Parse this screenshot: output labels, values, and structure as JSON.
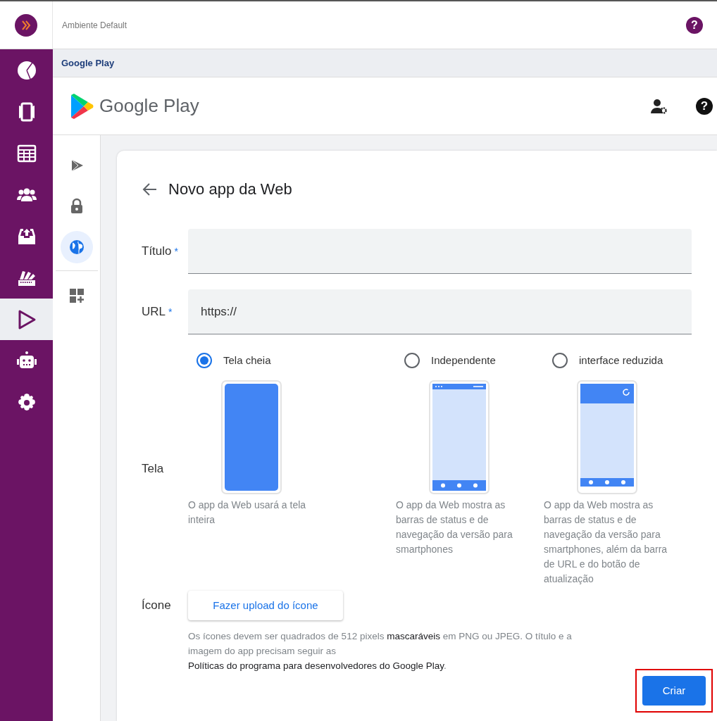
{
  "header": {
    "environment": "Ambiente Default",
    "help": "?"
  },
  "nav": [
    {
      "kind": "chart",
      "selected": false
    },
    {
      "kind": "phone",
      "selected": false
    },
    {
      "kind": "table",
      "selected": false
    },
    {
      "kind": "people",
      "selected": false
    },
    {
      "kind": "inbox",
      "selected": false
    },
    {
      "kind": "swatch",
      "selected": false
    },
    {
      "kind": "play",
      "selected": true
    },
    {
      "kind": "robot",
      "selected": false
    },
    {
      "kind": "gear",
      "selected": false
    }
  ],
  "breadcrumb": "Google Play",
  "brand": {
    "name": "Google Play",
    "help": "?"
  },
  "subnav": [
    {
      "kind": "play",
      "selected": false
    },
    {
      "kind": "lock",
      "selected": false
    },
    {
      "kind": "globe",
      "selected": true
    },
    {
      "kind": "grid",
      "selected": false
    }
  ],
  "form": {
    "title": "Novo app da Web",
    "fields": [
      {
        "label": "Título",
        "required": "*"
      },
      {
        "label": "URL",
        "required": "*",
        "value": "https://"
      }
    ],
    "screen_label": "Tela",
    "screen_options": [
      {
        "label": "Tela cheia",
        "selected": true,
        "kind": "full",
        "description": "O app da Web usará a tela inteira"
      },
      {
        "label": "Independente",
        "selected": false,
        "kind": "standalone",
        "description": "O app da Web mostra as barras de status e de navegação da versão para smartphones"
      },
      {
        "label": "interface reduzida",
        "selected": false,
        "kind": "minimal",
        "description": "O app da Web mostra as barras de status e de navegação da versão para smartphones, além da barra de URL e do botão de atualização"
      }
    ],
    "icon_label": "Ícone",
    "upload_button": "Fazer upload do ícone",
    "help": [
      {
        "kind": "text",
        "text": "Os ícones devem ser quadrados de 512 pixels "
      },
      {
        "kind": "link",
        "text": "mascaráveis"
      },
      {
        "kind": "text",
        "text": " em PNG ou JPEG. O título e a imagem do app precisam seguir as "
      },
      {
        "kind": "link",
        "text": "Políticas do programa para desenvolvedores do Google Play"
      },
      {
        "kind": "text",
        "text": "."
      }
    ],
    "submit": {
      "label": "Criar",
      "highlighted": true
    }
  }
}
